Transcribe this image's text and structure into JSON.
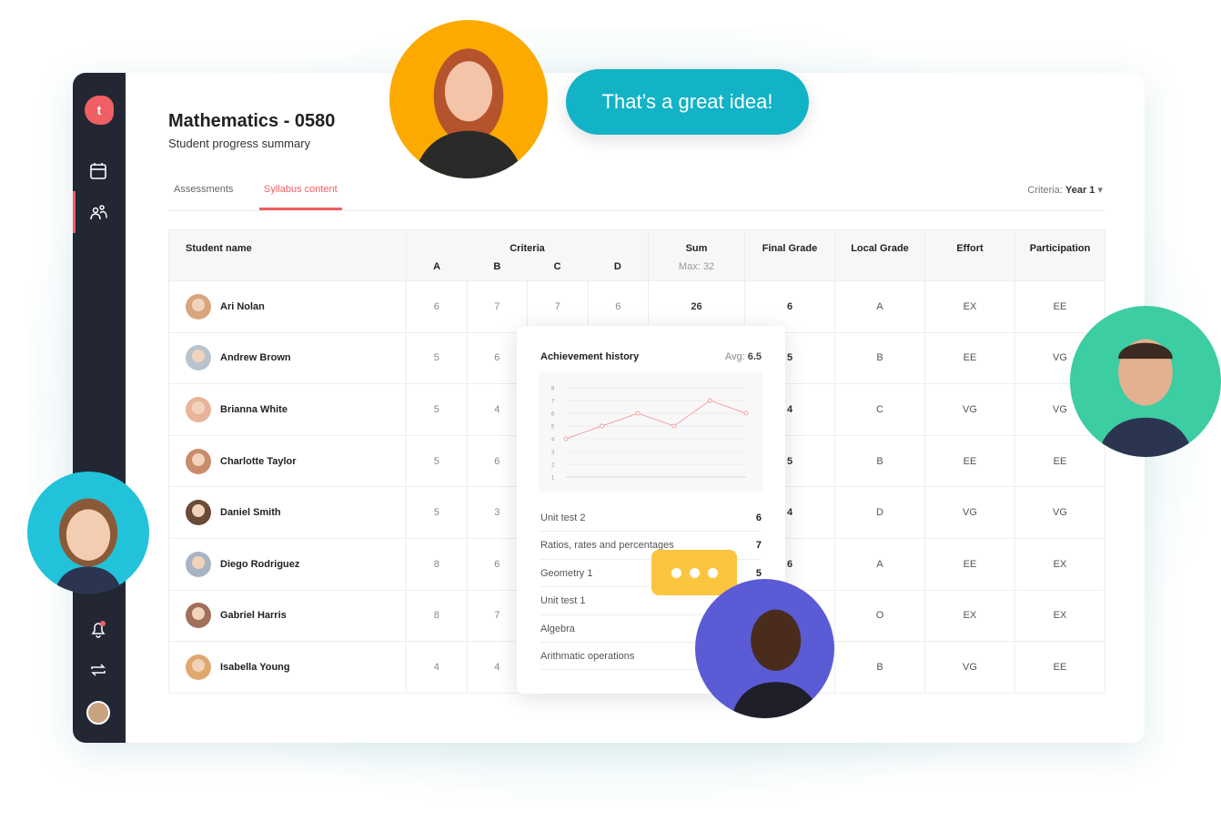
{
  "sidebar": {
    "logo": "t",
    "items": [
      {
        "icon": "calendar-icon"
      },
      {
        "icon": "users-icon",
        "active": true
      },
      {
        "icon": "bell-icon",
        "badge": "1"
      },
      {
        "icon": "sync-icon"
      },
      {
        "icon": "profile-avatar"
      }
    ]
  },
  "header": {
    "title": "Mathematics - 0580",
    "subtitle": "Student progress summary"
  },
  "tabs": [
    {
      "label": "Assessments"
    },
    {
      "label": "Syllabus content",
      "active": true
    }
  ],
  "criteria_filter": {
    "label": "Criteria:",
    "value": "Year 1"
  },
  "table": {
    "headers": {
      "name": "Student name",
      "criteria": "Criteria",
      "sub": [
        "A",
        "B",
        "C",
        "D"
      ],
      "sum": "Sum",
      "sum_max": "Max: 32",
      "final": "Final Grade",
      "local": "Local Grade",
      "effort": "Effort",
      "participation": "Participation"
    },
    "rows": [
      {
        "name": "Ari Nolan",
        "a": "6",
        "b": "7",
        "c": "7",
        "d": "6",
        "sum": "26",
        "final": "6",
        "local": "A",
        "effort": "EX",
        "part": "EE"
      },
      {
        "name": "Andrew Brown",
        "a": "5",
        "b": "6",
        "c": "",
        "d": "",
        "sum": "",
        "final": "5",
        "local": "B",
        "effort": "EE",
        "part": "VG"
      },
      {
        "name": "Brianna White",
        "a": "5",
        "b": "4",
        "c": "",
        "d": "",
        "sum": "",
        "final": "4",
        "local": "C",
        "effort": "VG",
        "part": "VG"
      },
      {
        "name": "Charlotte Taylor",
        "a": "5",
        "b": "6",
        "c": "",
        "d": "",
        "sum": "",
        "final": "5",
        "local": "B",
        "effort": "EE",
        "part": "EE"
      },
      {
        "name": "Daniel Smith",
        "a": "5",
        "b": "3",
        "c": "",
        "d": "",
        "sum": "",
        "final": "4",
        "local": "D",
        "effort": "VG",
        "part": "VG"
      },
      {
        "name": "Diego Rodriguez",
        "a": "8",
        "b": "6",
        "c": "",
        "d": "",
        "sum": "",
        "final": "6",
        "local": "A",
        "effort": "EE",
        "part": "EX"
      },
      {
        "name": "Gabriel Harris",
        "a": "8",
        "b": "7",
        "c": "",
        "d": "",
        "sum": "",
        "final": "",
        "local": "O",
        "effort": "EX",
        "part": "EX"
      },
      {
        "name": "Isabella Young",
        "a": "4",
        "b": "4",
        "c": "",
        "d": "",
        "sum": "",
        "final": "",
        "local": "B",
        "effort": "VG",
        "part": "EE"
      }
    ]
  },
  "popover": {
    "title": "Achievement history",
    "avg_label": "Avg:",
    "avg_value": "6.5",
    "history": [
      {
        "label": "Unit test 2",
        "score": "6"
      },
      {
        "label": "Ratios, rates and percentages",
        "score": "7"
      },
      {
        "label": "Geometry 1",
        "score": "5"
      },
      {
        "label": "Unit test 1",
        "score": ""
      },
      {
        "label": "Algebra",
        "score": ""
      },
      {
        "label": "Arithmatic operations",
        "score": ""
      }
    ]
  },
  "chart_data": {
    "type": "line",
    "y_ticks": [
      "1",
      "2",
      "3",
      "4",
      "5",
      "6",
      "7",
      "8"
    ],
    "ylim": [
      1,
      8
    ],
    "values": [
      4,
      5,
      6,
      5,
      7,
      6
    ],
    "grid": true,
    "color": "#f2a3a3"
  },
  "chat": {
    "message": "That’s a great idea!"
  },
  "colors": {
    "accent": "#ef5f63",
    "sidebar": "#232733",
    "bubble": "#12b3c6",
    "typing": "#fcc540"
  }
}
